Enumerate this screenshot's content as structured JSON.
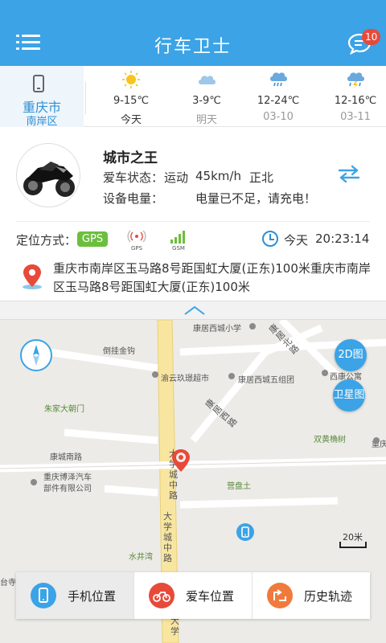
{
  "header": {
    "title": "行车卫士",
    "badge_count": "10"
  },
  "weather": {
    "city": "重庆市",
    "district": "南岸区",
    "days": [
      {
        "temp": "9-15℃",
        "date": "今天",
        "icon": "sun-icon",
        "date_color": "#333333"
      },
      {
        "temp": "3-9℃",
        "date": "明天",
        "icon": "cloud-icon",
        "date_color": "#999999"
      },
      {
        "temp": "12-24℃",
        "date": "03-10",
        "icon": "cloud-rain-icon",
        "date_color": "#999999"
      },
      {
        "temp": "12-16℃",
        "date": "03-11",
        "icon": "thunderstorm-icon",
        "date_color": "#999999"
      }
    ]
  },
  "car": {
    "name": "城市之王",
    "status_label": "爱车状态：",
    "status_mode": "运动",
    "speed": "45km/h",
    "direction": "正北",
    "battery_label": "设备电量：",
    "battery_text": "电量已不足，请充电！",
    "location_label": "定位方式：",
    "location_mode": "GPS",
    "signal_gps": "GPS",
    "signal_gsm": "GSM",
    "date": "今天",
    "time": "20:23:14",
    "address": "重庆市南岸区玉马路8号距国虹大厦(正东)100米重庆市南岸区玉马路8号距国虹大厦(正东)100米"
  },
  "map": {
    "labels": [
      {
        "text": "康居西城小学",
        "green": false
      },
      {
        "text": "倒挂金钩",
        "green": true
      },
      {
        "text": "渝云玖璟超市",
        "green": false
      },
      {
        "text": "康居西城五组团",
        "green": false
      },
      {
        "text": "西康公寓",
        "green": false
      },
      {
        "text": "朱家大朝门",
        "green": true
      },
      {
        "text": "双黄桷树",
        "green": true
      },
      {
        "text": "重庆合",
        "green": false
      },
      {
        "text": "康城南路",
        "green": false
      },
      {
        "text": "重庆博泽汽车部件有限公司",
        "green": false
      },
      {
        "text": "营盘土",
        "green": true
      },
      {
        "text": "水井湾",
        "green": true
      },
      {
        "text": "台寺",
        "green": false
      }
    ],
    "roads": [
      "康居北路",
      "康居西路",
      "大学城中路",
      "大学城中路",
      "大学"
    ],
    "btn_2d": "2D图",
    "btn_satellite": "卫星图",
    "scale": "20米"
  },
  "bottom_tabs": [
    {
      "label": "手机位置",
      "color": "#3ba3e6",
      "icon": "phone-icon"
    },
    {
      "label": "爱车位置",
      "color": "#e84a3a",
      "icon": "motorcycle-icon"
    },
    {
      "label": "历史轨迹",
      "color": "#f07a3c",
      "icon": "history-icon"
    }
  ],
  "colors": {
    "primary": "#3ba3e6",
    "alert": "#e84a3a",
    "gps_green": "#6bbf3d"
  }
}
